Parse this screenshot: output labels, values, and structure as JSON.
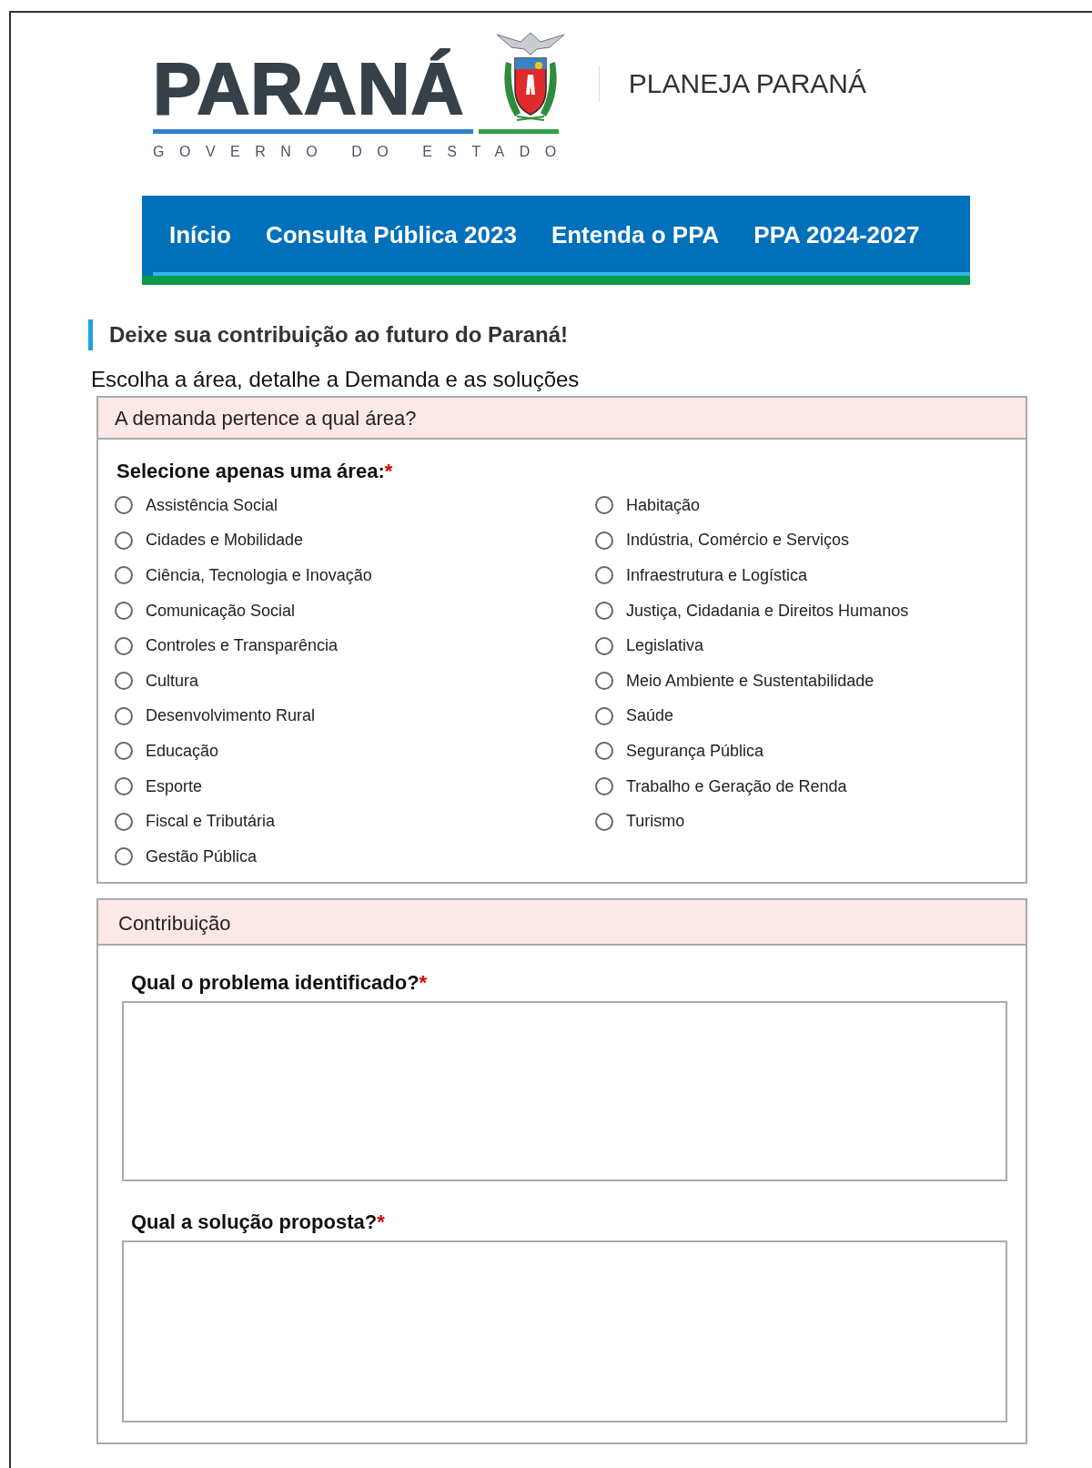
{
  "logo": {
    "wordmark": "PARANÁ",
    "tagline": "GOVERNO DO ESTADO"
  },
  "site_title": "PLANEJA PARANÁ",
  "nav": [
    {
      "label": "Início"
    },
    {
      "label": "Consulta Pública 2023"
    },
    {
      "label": "Entenda o PPA"
    },
    {
      "label": "PPA 2024-2027"
    }
  ],
  "heading": "Deixe sua contribuição ao futuro do Paraná!",
  "subtitle": "Escolha a área, detalhe a Demanda e as soluções",
  "area_panel": {
    "title": "A demanda pertence a qual área?",
    "label": "Selecione apenas uma área:",
    "required_mark": "*",
    "columns": [
      [
        {
          "label": "Assistência Social",
          "selected": false
        },
        {
          "label": "Cidades e Mobilidade",
          "selected": false
        },
        {
          "label": "Ciência, Tecnologia e Inovação",
          "selected": false
        },
        {
          "label": "Comunicação Social",
          "selected": false
        },
        {
          "label": "Controles e Transparência",
          "selected": false
        },
        {
          "label": "Cultura",
          "selected": false
        },
        {
          "label": "Desenvolvimento Rural",
          "selected": false
        },
        {
          "label": "Educação",
          "selected": false
        },
        {
          "label": "Esporte",
          "selected": false
        },
        {
          "label": "Fiscal e Tributária",
          "selected": false
        },
        {
          "label": "Gestão Pública",
          "selected": false
        }
      ],
      [
        {
          "label": "Habitação",
          "selected": false
        },
        {
          "label": "Indústria, Comércio e Serviços",
          "selected": false
        },
        {
          "label": "Infraestrutura e Logística",
          "selected": false
        },
        {
          "label": "Justiça, Cidadania e Direitos Humanos",
          "selected": false
        },
        {
          "label": "Legislativa",
          "selected": false
        },
        {
          "label": "Meio Ambiente e Sustentabilidade",
          "selected": false
        },
        {
          "label": "Saúde",
          "selected": false
        },
        {
          "label": "Segurança Pública",
          "selected": false
        },
        {
          "label": "Trabalho e Geração de Renda",
          "selected": false
        },
        {
          "label": "Turismo",
          "selected": false
        }
      ]
    ]
  },
  "contribution_panel": {
    "title": "Contribuição",
    "fields": [
      {
        "label": "Qual o problema identificado?",
        "required_mark": "*"
      },
      {
        "label": "Qual a solução proposta?",
        "required_mark": "*"
      }
    ]
  }
}
